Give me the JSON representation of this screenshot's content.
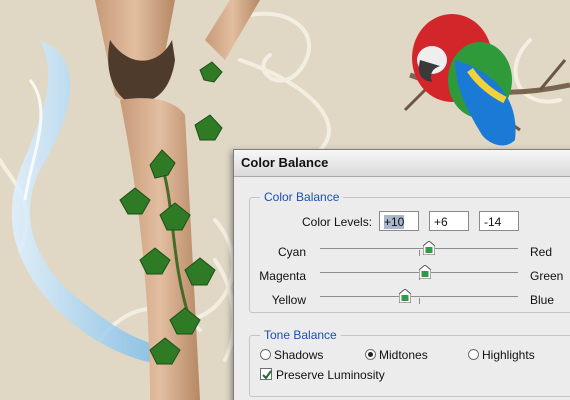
{
  "dialog": {
    "title": "Color Balance",
    "color_balance": {
      "group_title": "Color Balance",
      "levels_label": "Color Levels:",
      "levels": [
        "+10",
        "+6",
        "-14"
      ],
      "sliders": [
        {
          "left": "Cyan",
          "right": "Red",
          "value": 10
        },
        {
          "left": "Magenta",
          "right": "Green",
          "value": 6
        },
        {
          "left": "Yellow",
          "right": "Blue",
          "value": -14
        }
      ],
      "slider_range": [
        -100,
        100
      ]
    },
    "tone_balance": {
      "group_title": "Tone Balance",
      "options": [
        "Shadows",
        "Midtones",
        "Highlights"
      ],
      "selected": "Midtones",
      "preserve_label": "Preserve Luminosity",
      "preserve_checked": true
    }
  },
  "colors": {
    "group_title": "#1a4fb5",
    "thumb": "#2e9a4a",
    "background": "#e3dccb"
  }
}
